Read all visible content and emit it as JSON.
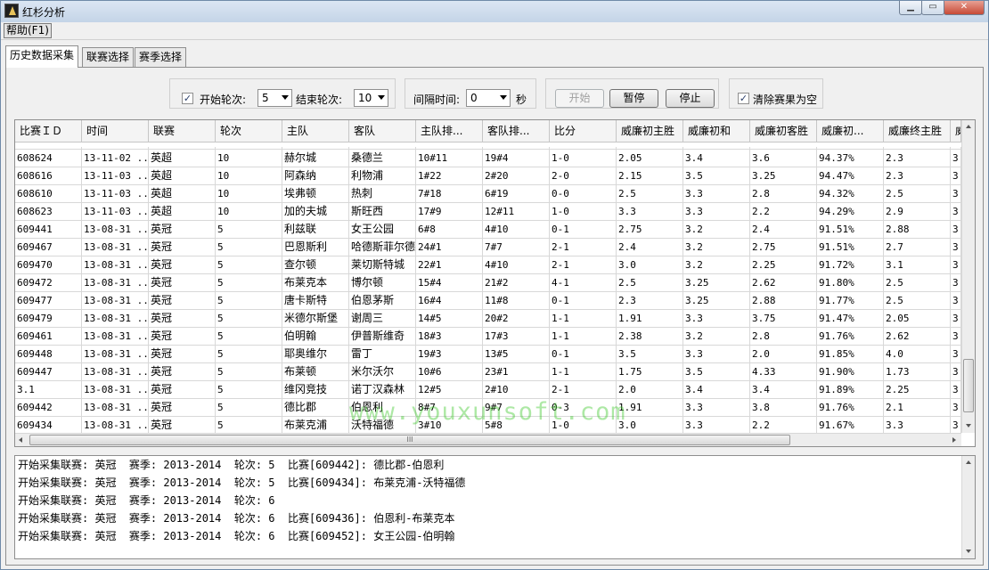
{
  "window": {
    "title": "红杉分析"
  },
  "menu": {
    "items": [
      {
        "label": "帮助(F1)"
      }
    ]
  },
  "tabs": [
    {
      "label": "历史数据采集",
      "active": true
    },
    {
      "label": "联赛选择",
      "active": false
    },
    {
      "label": "赛季选择",
      "active": false
    }
  ],
  "controls": {
    "start_round_checked": true,
    "start_round_label": "开始轮次:",
    "start_round_value": "5",
    "end_round_label": "结束轮次:",
    "end_round_value": "10",
    "interval_label": "间隔时间:",
    "interval_value": "0",
    "interval_unit": "秒",
    "start_button": "开始",
    "pause_button": "暂停",
    "stop_button": "停止",
    "clear_checked": true,
    "clear_label": "清除赛果为空"
  },
  "grid": {
    "columns": [
      "比赛ＩＤ",
      "时间",
      "联赛",
      "轮次",
      "主队",
      "客队",
      "主队排...",
      "客队排...",
      "比分",
      "威廉初主胜",
      "威廉初和",
      "威廉初客胜",
      "威廉初...",
      "威廉终主胜",
      "威"
    ],
    "partial_top_row": [
      "",
      "",
      "",
      "",
      "",
      "",
      "",
      "",
      "",
      "",
      "",
      "",
      "",
      "",
      ""
    ],
    "rows": [
      [
        "608624",
        "13-11-02 ...",
        "英超",
        "10",
        "赫尔城",
        "桑德兰",
        "10#11",
        "19#4",
        "1-0",
        "2.05",
        "3.4",
        "3.6",
        "94.37%",
        "2.3",
        "3."
      ],
      [
        "608616",
        "13-11-03 ...",
        "英超",
        "10",
        "阿森纳",
        "利物浦",
        "1#22",
        "2#20",
        "2-0",
        "2.15",
        "3.5",
        "3.25",
        "94.47%",
        "2.3",
        "3."
      ],
      [
        "608610",
        "13-11-03 ...",
        "英超",
        "10",
        "埃弗顿",
        "热刺",
        "7#18",
        "6#19",
        "0-0",
        "2.5",
        "3.3",
        "2.8",
        "94.32%",
        "2.5",
        "3."
      ],
      [
        "608623",
        "13-11-03 ...",
        "英超",
        "10",
        "加的夫城",
        "斯旺西",
        "17#9",
        "12#11",
        "1-0",
        "3.3",
        "3.3",
        "2.2",
        "94.29%",
        "2.9",
        "3."
      ],
      [
        "609441",
        "13-08-31 ...",
        "英冠",
        "5",
        "利兹联",
        "女王公园",
        "6#8",
        "4#10",
        "0-1",
        "2.75",
        "3.2",
        "2.4",
        "91.51%",
        "2.88",
        "3."
      ],
      [
        "609467",
        "13-08-31 ...",
        "英冠",
        "5",
        "巴恩斯利",
        "哈德斯菲尔德",
        "24#1",
        "7#7",
        "2-1",
        "2.4",
        "3.2",
        "2.75",
        "91.51%",
        "2.7",
        "3."
      ],
      [
        "609470",
        "13-08-31 ...",
        "英冠",
        "5",
        "查尔顿",
        "莱切斯特城",
        "22#1",
        "4#10",
        "2-1",
        "3.0",
        "3.2",
        "2.25",
        "91.72%",
        "3.1",
        "3."
      ],
      [
        "609472",
        "13-08-31 ...",
        "英冠",
        "5",
        "布莱克本",
        "博尔顿",
        "15#4",
        "21#2",
        "4-1",
        "2.5",
        "3.25",
        "2.62",
        "91.80%",
        "2.5",
        "3."
      ],
      [
        "609477",
        "13-08-31 ...",
        "英冠",
        "5",
        "唐卡斯特",
        "伯恩茅斯",
        "16#4",
        "11#8",
        "0-1",
        "2.3",
        "3.25",
        "2.88",
        "91.77%",
        "2.5",
        "3."
      ],
      [
        "609479",
        "13-08-31 ...",
        "英冠",
        "5",
        "米德尔斯堡",
        "谢周三",
        "14#5",
        "20#2",
        "1-1",
        "1.91",
        "3.3",
        "3.75",
        "91.47%",
        "2.05",
        "3."
      ],
      [
        "609461",
        "13-08-31 ...",
        "英冠",
        "5",
        "伯明翰",
        "伊普斯维奇",
        "18#3",
        "17#3",
        "1-1",
        "2.38",
        "3.2",
        "2.8",
        "91.76%",
        "2.62",
        "3."
      ],
      [
        "609448",
        "13-08-31 ...",
        "英冠",
        "5",
        "耶奥维尔",
        "雷丁",
        "19#3",
        "13#5",
        "0-1",
        "3.5",
        "3.3",
        "2.0",
        "91.85%",
        "4.0",
        "3."
      ],
      [
        "609447",
        "13-08-31 ...",
        "英冠",
        "5",
        "布莱顿",
        "米尔沃尔",
        "10#6",
        "23#1",
        "1-1",
        "1.75",
        "3.5",
        "4.33",
        "91.90%",
        "1.73",
        "3."
      ],
      [
        "3.1",
        "13-08-31 ...",
        "英冠",
        "5",
        "维冈竞技",
        "诺丁汉森林",
        "12#5",
        "2#10",
        "2-1",
        "2.0",
        "3.4",
        "3.4",
        "91.89%",
        "2.25",
        "3."
      ],
      [
        "609442",
        "13-08-31 ...",
        "英冠",
        "5",
        "德比郡",
        "伯恩利",
        "8#7",
        "9#7",
        "0-3",
        "1.91",
        "3.3",
        "3.8",
        "91.76%",
        "2.1",
        "3."
      ],
      [
        "609434",
        "13-08-31 ...",
        "英冠",
        "5",
        "布莱克浦",
        "沃特福德",
        "3#10",
        "5#8",
        "1-0",
        "3.0",
        "3.3",
        "2.2",
        "91.67%",
        "3.3",
        "3."
      ]
    ],
    "hscroll_grip": "III"
  },
  "watermark": "www.youxunsoft.com",
  "log": {
    "lines": [
      "开始采集联赛: 英冠  赛季: 2013-2014  轮次: 5  比赛[609442]: 德比郡-伯恩利",
      "开始采集联赛: 英冠  赛季: 2013-2014  轮次: 5  比赛[609434]: 布莱克浦-沃特福德",
      "开始采集联赛: 英冠  赛季: 2013-2014  轮次: 6",
      "开始采集联赛: 英冠  赛季: 2013-2014  轮次: 6  比赛[609436]: 伯恩利-布莱克本",
      "开始采集联赛: 英冠  赛季: 2013-2014  轮次: 6  比赛[609452]: 女王公园-伯明翰"
    ]
  },
  "icons": {
    "app": "red-cedar-logo-icon",
    "checkbox": "checkbox-checked-icon",
    "dropdown": "chevron-down-icon"
  }
}
